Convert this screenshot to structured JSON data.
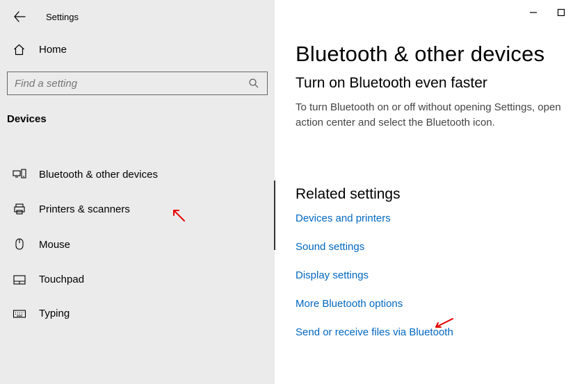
{
  "header": {
    "app_title": "Settings"
  },
  "home_label": "Home",
  "search": {
    "placeholder": "Find a setting"
  },
  "section_heading": "Devices",
  "nav": [
    {
      "label": "Bluetooth & other devices"
    },
    {
      "label": "Printers & scanners"
    },
    {
      "label": "Mouse"
    },
    {
      "label": "Touchpad"
    },
    {
      "label": "Typing"
    }
  ],
  "page": {
    "title": "Bluetooth & other devices",
    "subheading": "Turn on Bluetooth even faster",
    "helptext": "To turn Bluetooth on or off without opening Settings, open action center and select the Bluetooth icon."
  },
  "related": {
    "heading": "Related settings",
    "links": [
      "Devices and printers",
      "Sound settings",
      "Display settings",
      "More Bluetooth options",
      "Send or receive files via Bluetooth"
    ]
  }
}
